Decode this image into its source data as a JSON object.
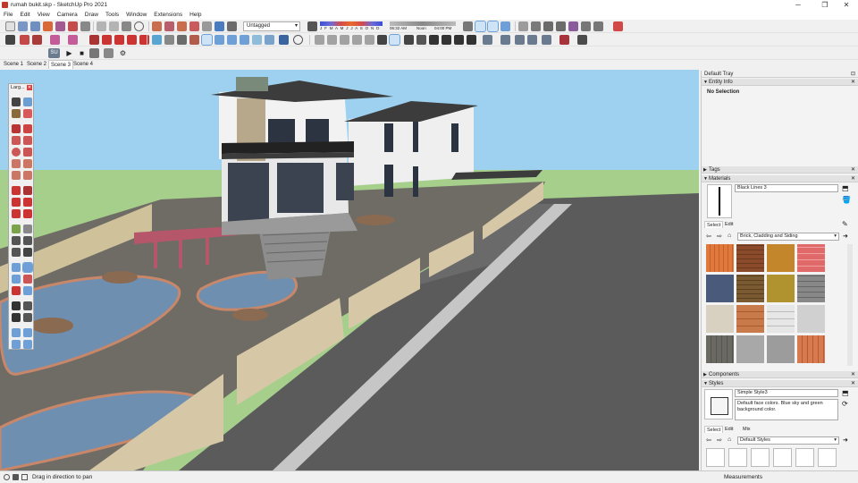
{
  "window": {
    "title": "rumah bukit.skp - SketchUp Pro 2021",
    "controls": [
      "─",
      "❐",
      "✕"
    ]
  },
  "menu": [
    "File",
    "Edit",
    "View",
    "Camera",
    "Draw",
    "Tools",
    "Window",
    "Extensions",
    "Help"
  ],
  "toolbar": {
    "tag_dropdown": "Untagged",
    "months": "J F M A M J J A S O N D",
    "time_start": "06:32 AM",
    "time_noon": "Noon",
    "time_end": "04:00 PM",
    "scene_icon": "SU"
  },
  "scenes": [
    "Scene 1",
    "Scene 2",
    "Scene 3",
    "Scene 4"
  ],
  "active_scene": "Scene 3",
  "large_toolset": {
    "title": "Larg...",
    "close": "✕"
  },
  "tray": {
    "title": "Default Tray",
    "entity_info": {
      "header": "Entity Info",
      "value": "No Selection"
    },
    "tags_header": "Tags",
    "materials": {
      "header": "Materials",
      "material_name": "Black Lines 3",
      "tabs": [
        "Select",
        "Edit"
      ],
      "library": "Brick, Cladding and Siding"
    },
    "components_header": "Components",
    "styles": {
      "header": "Styles",
      "style_name": "Simple Style3",
      "description": "Default face colors. Blue sky and green background color.",
      "tabs": [
        "Select",
        "Edit",
        "Mix"
      ],
      "library": "Default Styles"
    }
  },
  "status": {
    "message": "Drag in direction to pan",
    "measurements_label": "Measurements"
  },
  "colors": {
    "sky": "#9ed0ef",
    "ground": "#a6cf8c",
    "road": "#5b5b5b",
    "accent": "#6ea1d6"
  }
}
